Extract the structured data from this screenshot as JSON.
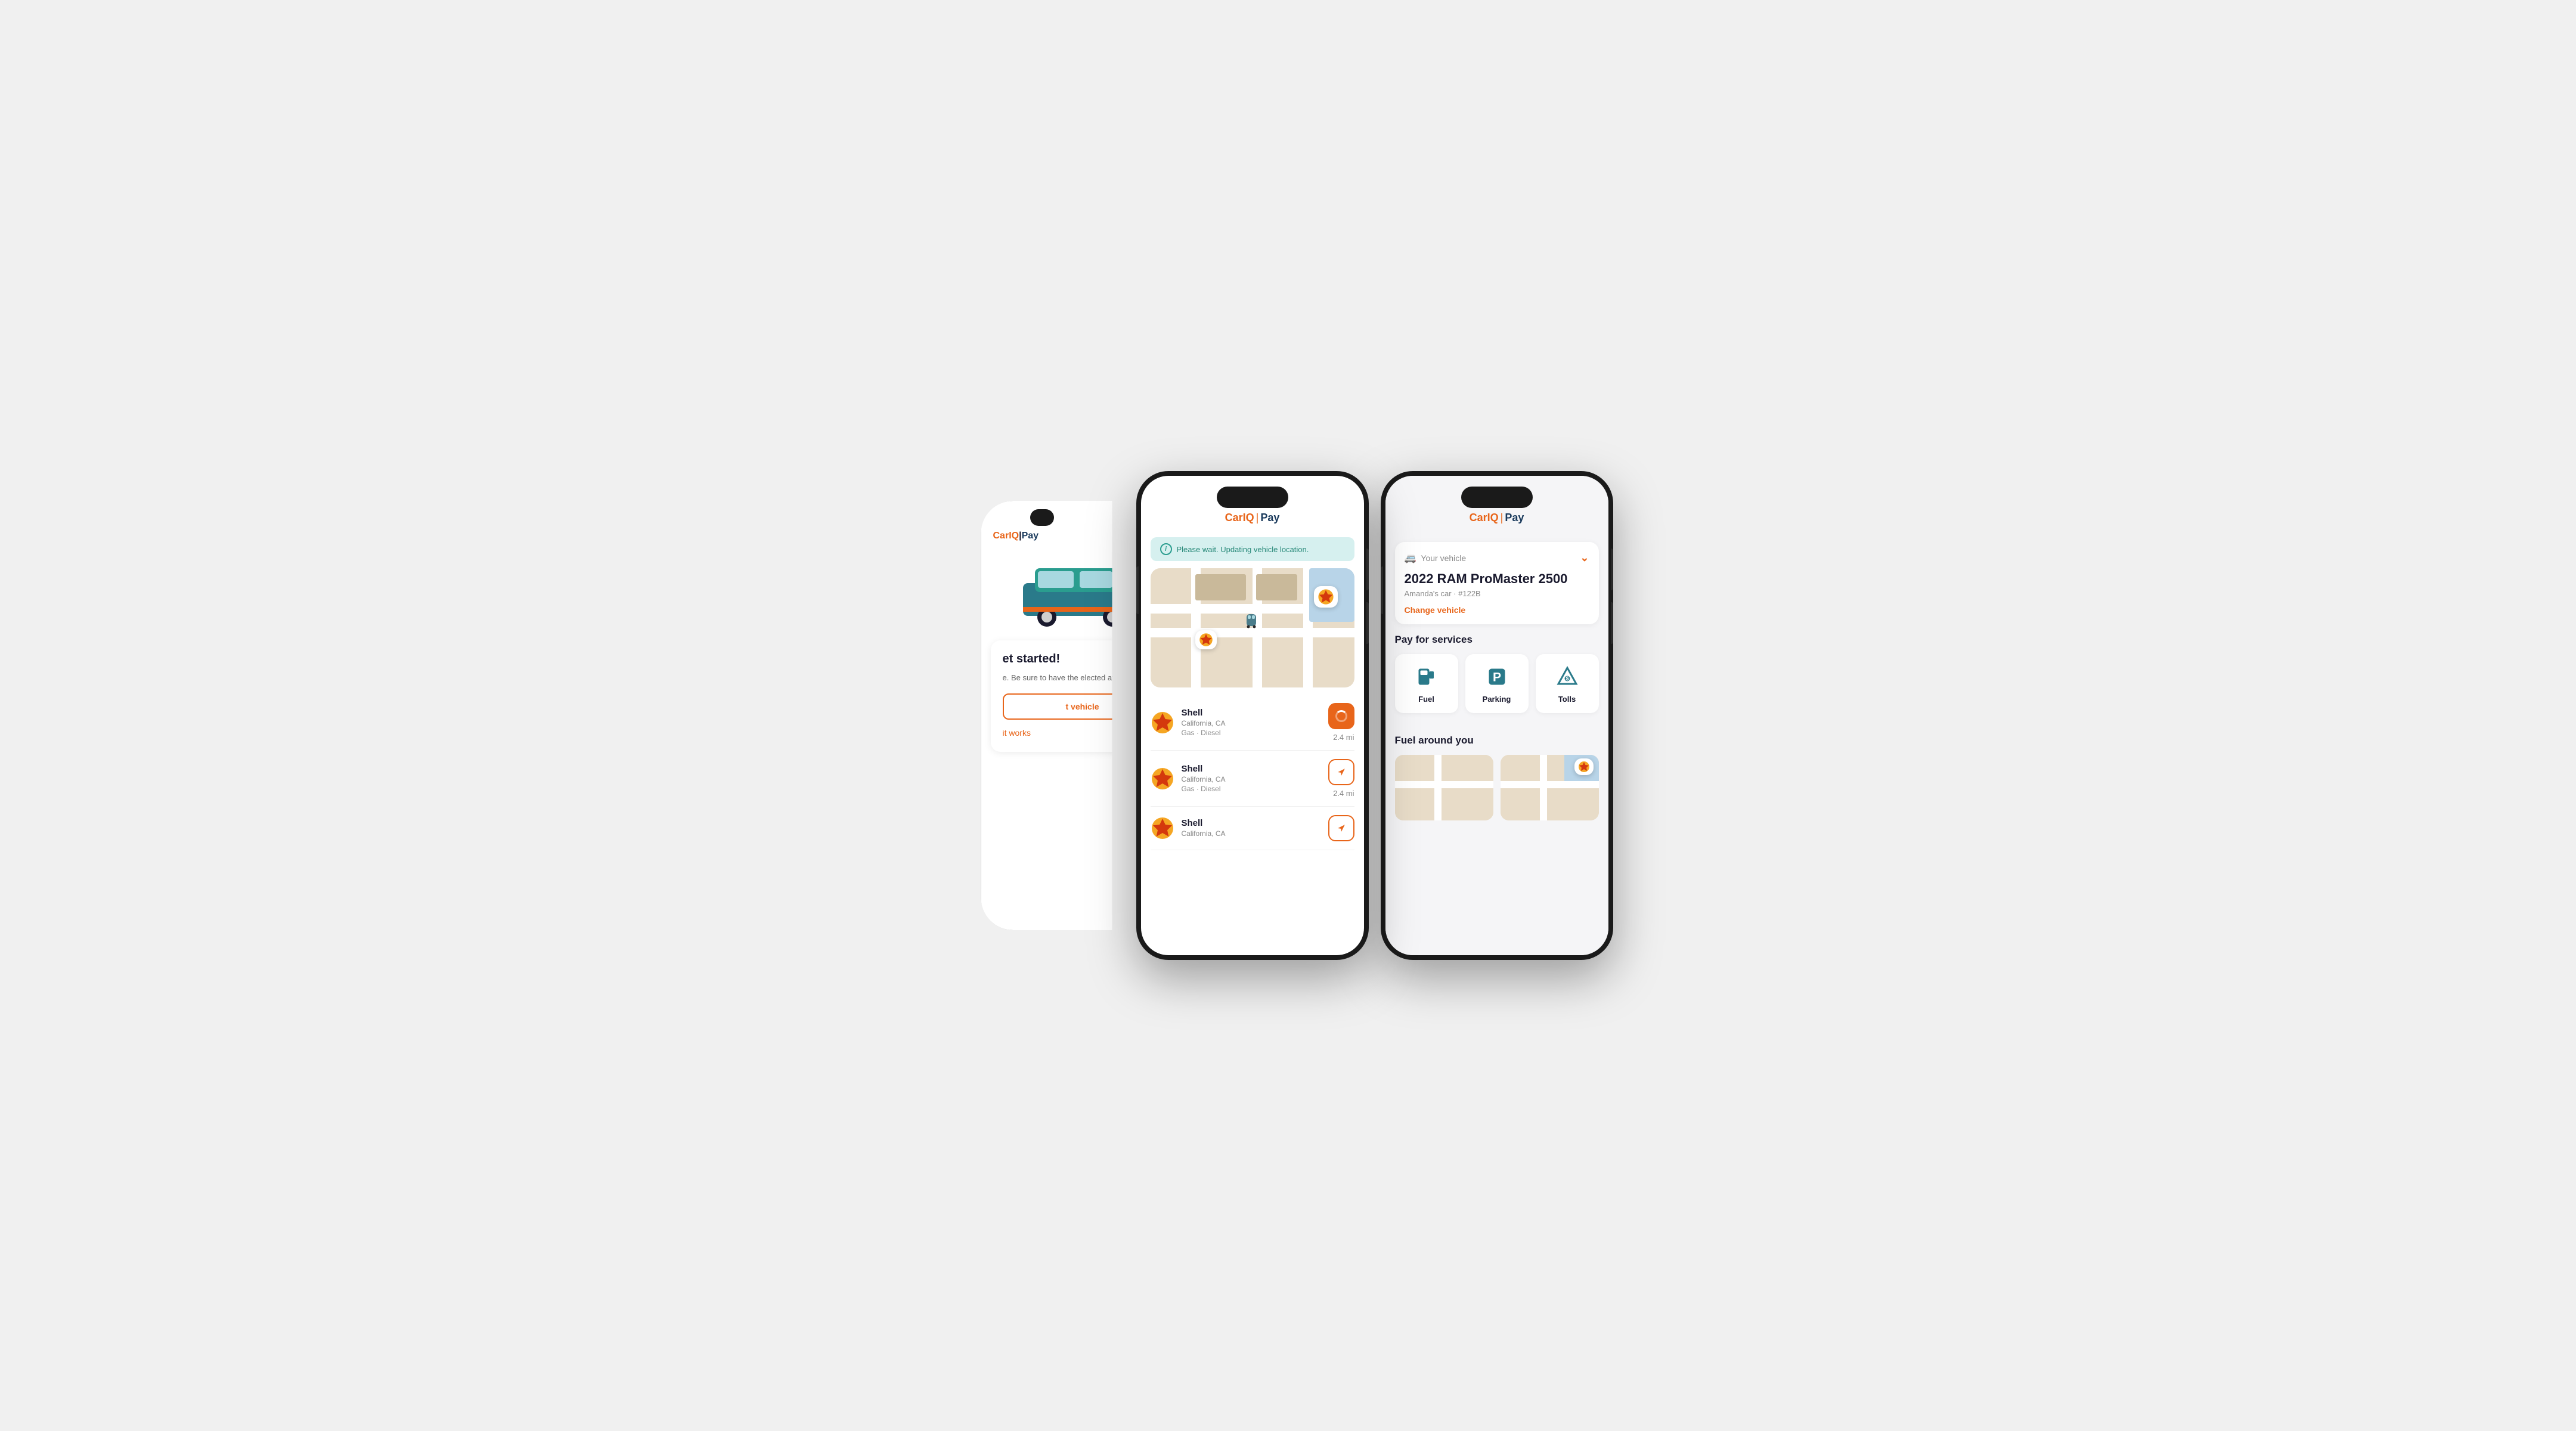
{
  "app": {
    "brand_car": "Car",
    "brand_iq": "IQ",
    "brand_sep": "|",
    "brand_pay": "Pay"
  },
  "phone1": {
    "title_car": "Car",
    "title_iq": "IQ",
    "title_sep": "|",
    "title_pay": "Pay",
    "heading": "et started!",
    "description": "e. Be sure to have the\nelected at all times.",
    "btn_vehicle": "t vehicle",
    "link_works": "it works"
  },
  "phone2": {
    "status_message": "Please wait. Updating vehicle location.",
    "station1": {
      "name": "Shell",
      "location": "California, CA",
      "tags": "Gas · Diesel",
      "distance": "2.4 mi",
      "action": "loading"
    },
    "station2": {
      "name": "Shell",
      "location": "California, CA",
      "tags": "Gas · Diesel",
      "distance": "2.4 mi",
      "action": "navigate"
    },
    "station3": {
      "name": "Shell",
      "location": "California, CA",
      "action": "navigate"
    }
  },
  "phone3": {
    "vehicle_label": "Your vehicle",
    "vehicle_name": "2022 RAM ProMaster 2500",
    "vehicle_sub": "Amanda's car · #122B",
    "change_vehicle": "Change vehicle",
    "services_title": "Pay for services",
    "services": [
      {
        "label": "Fuel",
        "icon": "fuel"
      },
      {
        "label": "Parking",
        "icon": "parking"
      },
      {
        "label": "Tolls",
        "icon": "tolls"
      }
    ],
    "fuel_section_title": "Fuel around you"
  }
}
